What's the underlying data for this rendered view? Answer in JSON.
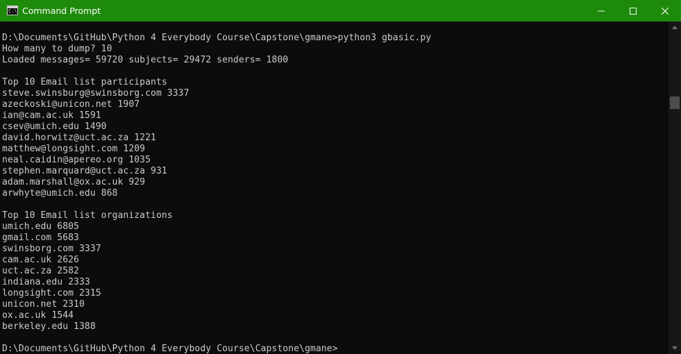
{
  "window": {
    "title": "Command Prompt",
    "icon": "cmd-icon",
    "icon_glyph": "C:\\"
  },
  "titlebar_controls": {
    "minimize_icon": "minimize-icon",
    "maximize_icon": "maximize-icon",
    "close_icon": "close-icon"
  },
  "colors": {
    "titlebar": "#1e8a0b",
    "console_background": "#0c0c0c",
    "console_text": "#cccccc"
  },
  "console": {
    "lines": [
      "D:\\Documents\\GitHub\\Python 4 Everybody Course\\Capstone\\gmane>python3 gbasic.py",
      "How many to dump? 10",
      "Loaded messages= 59720 subjects= 29472 senders= 1800",
      "",
      "Top 10 Email list participants",
      "steve.swinsburg@swinsborg.com 3337",
      "azeckoski@unicon.net 1907",
      "ian@cam.ac.uk 1591",
      "csev@umich.edu 1490",
      "david.horwitz@uct.ac.za 1221",
      "matthew@longsight.com 1209",
      "neal.caidin@apereo.org 1035",
      "stephen.marquard@uct.ac.za 931",
      "adam.marshall@ox.ac.uk 929",
      "arwhyte@umich.edu 868",
      "",
      "Top 10 Email list organizations",
      "umich.edu 6805",
      "gmail.com 5683",
      "swinsborg.com 3337",
      "cam.ac.uk 2626",
      "uct.ac.za 2582",
      "indiana.edu 2333",
      "longsight.com 2315",
      "unicon.net 2310",
      "ox.ac.uk 1544",
      "berkeley.edu 1388",
      "",
      "D:\\Documents\\GitHub\\Python 4 Everybody Course\\Capstone\\gmane>"
    ]
  },
  "scrollbar": {
    "up_icon": "scroll-up-arrow-icon",
    "down_icon": "scroll-down-arrow-icon"
  }
}
